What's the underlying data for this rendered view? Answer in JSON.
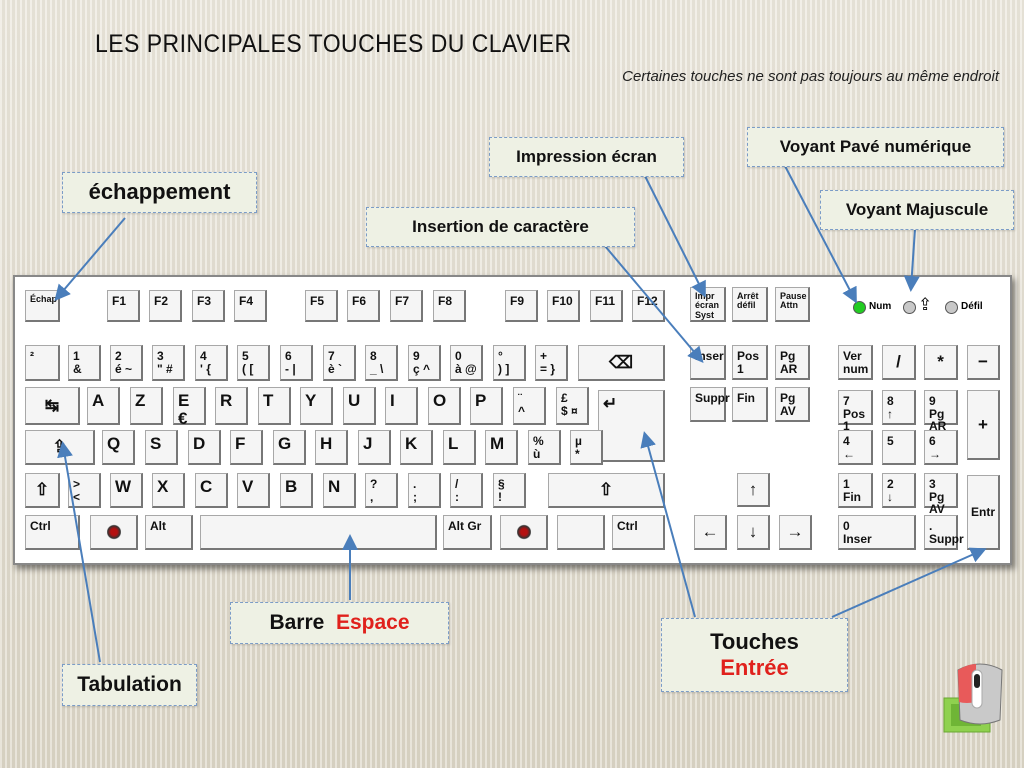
{
  "title": "LES  PRINCIPALES  TOUCHES  DU  CLAVIER",
  "subtitle": "Certaines touches ne sont pas toujours au même endroit",
  "callouts": {
    "echap": "échappement",
    "impression": "Impression écran",
    "insertion": "Insertion de caractère",
    "voyant_num": "Voyant Pavé numérique",
    "voyant_maj": "Voyant Majuscule",
    "espace_prefix": "Barre",
    "espace_highlight": "Espace",
    "entree_prefix": "Touches",
    "entree_highlight": "Entrée",
    "tabulation": "Tabulation"
  },
  "colors": {
    "highlight": "#e0211c",
    "arrow": "#4a7ebb",
    "led_on": "#22cc22",
    "led_off": "#c8c8c8"
  },
  "leds": {
    "num": "Num",
    "maj_icon": "caps-lock-icon",
    "defil": "Défil"
  },
  "keys": [
    {
      "label": "Échap"
    },
    {
      "label": "F1"
    },
    {
      "label": "F2"
    },
    {
      "label": "F3"
    },
    {
      "label": "F4"
    },
    {
      "label": "F5"
    },
    {
      "label": "F6"
    },
    {
      "label": "F7"
    },
    {
      "label": "F8"
    },
    {
      "label": "F9"
    },
    {
      "label": "F10"
    },
    {
      "label": "F11"
    },
    {
      "label": "F12"
    },
    {
      "label": "Impr\nécran\nSyst"
    },
    {
      "label": "Arrêt\ndéfil"
    },
    {
      "label": "Pause\nAttn"
    },
    {
      "label": "²"
    },
    {
      "label": "1\n&"
    },
    {
      "label": "2\né  ~"
    },
    {
      "label": "3\n\"  #"
    },
    {
      "label": "4\n'  {"
    },
    {
      "label": "5\n(  ["
    },
    {
      "label": "6\n-  |"
    },
    {
      "label": "7\nè  `"
    },
    {
      "label": "8\n_  \\"
    },
    {
      "label": "9\nç  ^"
    },
    {
      "label": "0\nà  @"
    },
    {
      "label": "°\n)  ]"
    },
    {
      "label": "+\n=  }"
    },
    {
      "icon": "backspace-icon"
    },
    {
      "label": "Inser"
    },
    {
      "label": "Pos 1"
    },
    {
      "label": "Pg AR"
    },
    {
      "label": "Ver\nnum"
    },
    {
      "label": "/"
    },
    {
      "label": "*"
    },
    {
      "label": "−"
    },
    {
      "icon": "tab-icon"
    },
    {
      "label": "A"
    },
    {
      "label": "Z"
    },
    {
      "label": "E\n   €"
    },
    {
      "label": "R"
    },
    {
      "label": "T"
    },
    {
      "label": "Y"
    },
    {
      "label": "U"
    },
    {
      "label": "I"
    },
    {
      "label": "O"
    },
    {
      "label": "P"
    },
    {
      "label": "¨\n^"
    },
    {
      "label": "£\n$  ¤"
    },
    {
      "icon": "enter-icon"
    },
    {
      "label": "Suppr"
    },
    {
      "label": "Fin"
    },
    {
      "label": "Pg AV"
    },
    {
      "label": "7\nPos 1"
    },
    {
      "label": "8\n ↑"
    },
    {
      "label": "9\nPg AR"
    },
    {
      "label": "+"
    },
    {
      "icon": "caps-lock-icon"
    },
    {
      "label": "Q"
    },
    {
      "label": "S"
    },
    {
      "label": "D"
    },
    {
      "label": "F"
    },
    {
      "label": "G"
    },
    {
      "label": "H"
    },
    {
      "label": "J"
    },
    {
      "label": "K"
    },
    {
      "label": "L"
    },
    {
      "label": "M"
    },
    {
      "label": "%\nù"
    },
    {
      "label": "µ\n*"
    },
    {
      "label": "4\n←"
    },
    {
      "label": "5"
    },
    {
      "label": "6\n→"
    },
    {
      "icon": "shift-icon"
    },
    {
      "label": ">\n<"
    },
    {
      "label": "W"
    },
    {
      "label": "X"
    },
    {
      "label": "C"
    },
    {
      "label": "V"
    },
    {
      "label": "B"
    },
    {
      "label": "N"
    },
    {
      "label": "?\n,"
    },
    {
      "label": ".\n;"
    },
    {
      "label": "/\n:"
    },
    {
      "label": "§\n!"
    },
    {
      "icon": "shift-icon"
    },
    {
      "icon": "arrow-up-icon"
    },
    {
      "label": "1\nFin"
    },
    {
      "label": "2\n ↓"
    },
    {
      "label": "3\nPg AV"
    },
    {
      "label": "Entr"
    },
    {
      "label": "Ctrl"
    },
    {
      "icon": "windows-icon"
    },
    {
      "label": "Alt"
    },
    {
      "label": ""
    },
    {
      "label": "Alt Gr"
    },
    {
      "icon": "windows-icon"
    },
    {
      "label": ""
    },
    {
      "label": "Ctrl"
    },
    {
      "icon": "arrow-left-icon"
    },
    {
      "icon": "arrow-down-icon"
    },
    {
      "icon": "arrow-right-icon"
    },
    {
      "label": "0\nInser"
    },
    {
      "label": ".\nSuppr"
    }
  ]
}
